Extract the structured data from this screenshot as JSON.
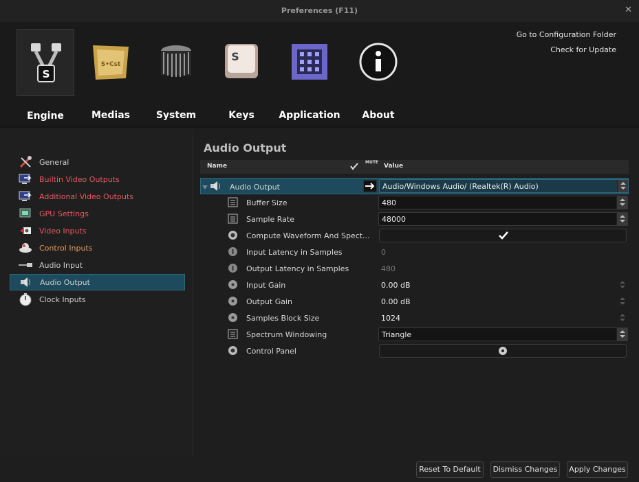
{
  "window": {
    "title": "Preferences (F11)"
  },
  "header": {
    "categories": [
      {
        "label": "Engine",
        "icon": "engine-pistons-icon"
      },
      {
        "label": "Medias",
        "icon": "medias-icon"
      },
      {
        "label": "System",
        "icon": "system-heatsink-icon"
      },
      {
        "label": "Keys",
        "icon": "keys-keycap-icon"
      },
      {
        "label": "Application",
        "icon": "application-chip-icon"
      },
      {
        "label": "About",
        "icon": "about-info-icon"
      }
    ],
    "links": {
      "config_folder": "Go to Configuration Folder",
      "check_update": "Check for Update"
    }
  },
  "sidebar": {
    "items": [
      {
        "label": "General",
        "icon": "tools-icon"
      },
      {
        "label": "Builtin Video Outputs",
        "icon": "monitor-arrow-icon"
      },
      {
        "label": "Additional Video Outputs",
        "icon": "monitor-arrow-icon"
      },
      {
        "label": "GPU Settings",
        "icon": "gpu-icon"
      },
      {
        "label": "Video Inputs",
        "icon": "camera-icon"
      },
      {
        "label": "Control Inputs",
        "icon": "controller-icon"
      },
      {
        "label": "Audio Input",
        "icon": "audio-cable-icon"
      },
      {
        "label": "Audio Output",
        "icon": "speaker-icon"
      },
      {
        "label": "Clock Inputs",
        "icon": "stopwatch-icon"
      }
    ]
  },
  "panel": {
    "title": "Audio Output",
    "columns": {
      "name": "Name",
      "mute": "MUTE",
      "value": "Value"
    },
    "header_row": {
      "label": "Audio Output",
      "value": "Audio/Windows Audio/ (Realtek(R) Audio)"
    },
    "rows": [
      {
        "label": "Buffer Size",
        "value": "480"
      },
      {
        "label": "Sample Rate",
        "value": "48000"
      },
      {
        "label": "Compute Waveform And Spect...",
        "value": ""
      },
      {
        "label": "Input Latency in Samples",
        "value": "0"
      },
      {
        "label": "Output Latency in Samples",
        "value": "480"
      },
      {
        "label": "Input Gain",
        "value": "0.00 dB"
      },
      {
        "label": "Output Gain",
        "value": "0.00 dB"
      },
      {
        "label": "Samples Block Size",
        "value": "1024"
      },
      {
        "label": "Spectrum Windowing",
        "value": "Triangle"
      },
      {
        "label": "Control Panel",
        "value": ""
      }
    ]
  },
  "footer": {
    "reset": "Reset To Default",
    "dismiss": "Dismiss Changes",
    "apply": "Apply Changes"
  },
  "colors": {
    "selection": "#1d4a5c",
    "sidebar_red": "#e8595e",
    "sidebar_orange": "#e59a5c"
  }
}
